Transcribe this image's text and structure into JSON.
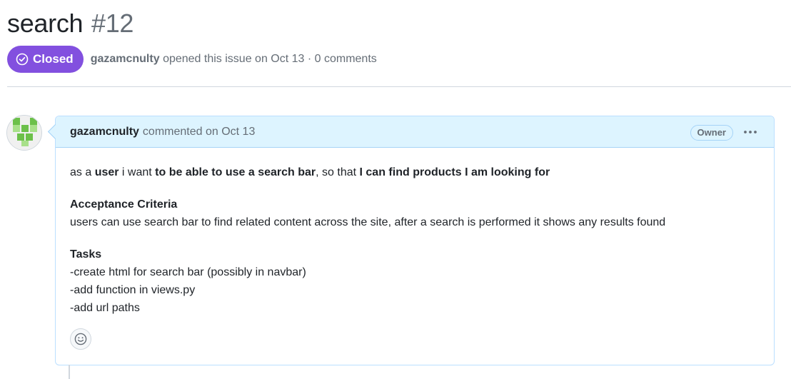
{
  "issue": {
    "title": "search",
    "number": "#12",
    "state": "Closed",
    "state_color": "#8250df",
    "author": "gazamcnulty",
    "opened_text": "opened this issue on Oct 13 · 0 comments"
  },
  "comment": {
    "author": "gazamcnulty",
    "action_text": "commented on Oct 13",
    "role_badge": "Owner",
    "story": {
      "p1": "as a ",
      "b1": "user",
      "p2": " i want ",
      "b2": "to be able to use a search bar",
      "p3": ", so that ",
      "b3": "I can find products I am looking for"
    },
    "criteria_heading": "Acceptance Criteria",
    "criteria_text": "users can use search bar to find related content across the site, after a search is performed it shows any results found",
    "tasks_heading": "Tasks",
    "tasks": [
      "-create html for search bar (possibly in navbar)",
      "-add function in views.py",
      "-add url paths"
    ]
  },
  "icons": {
    "state": "check-circle-icon",
    "more": "kebab-horizontal-icon",
    "reaction": "smiley-icon",
    "avatar": "identicon"
  }
}
